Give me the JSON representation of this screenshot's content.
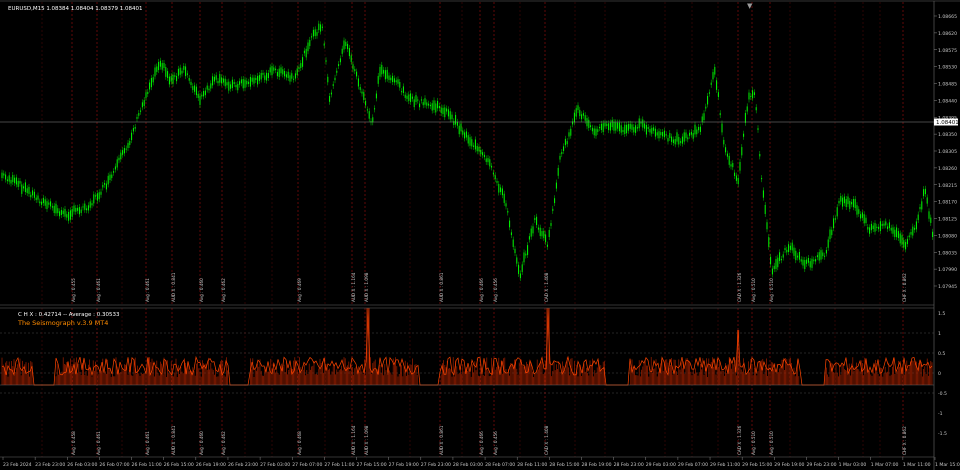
{
  "main": {
    "symbol_info": "EURUSD,M15  1.08384 1.08404 1.08379 1.08401",
    "current_price": "1.08401",
    "price_labels": [
      "1.08665",
      "1.08620",
      "1.08575",
      "1.08530",
      "1.08485",
      "1.08440",
      "1.08395",
      "1.08350",
      "1.08305",
      "1.08260",
      "1.08215",
      "1.08170",
      "1.08125",
      "1.08080",
      "1.08035",
      "1.07990",
      "1.07945"
    ]
  },
  "indicator": {
    "header": "C H X : 0.42714 -- Average : 0.30533",
    "title": "The Seismograph v.3.9 MT4",
    "levels": [
      "1.5",
      "1",
      "0.5",
      "0",
      "-0.5",
      "-1",
      "-1.5"
    ]
  },
  "time_axis": {
    "labels": [
      "23 Feb 2024",
      "23 Feb 23:00",
      "26 Feb 03:00",
      "26 Feb 07:00",
      "26 Feb 11:00",
      "26 Feb 15:00",
      "26 Feb 19:00",
      "26 Feb 23:00",
      "27 Feb 03:00",
      "27 Feb 07:00",
      "27 Feb 11:00",
      "27 Feb 15:00",
      "27 Feb 19:00",
      "27 Feb 23:00",
      "28 Feb 03:00",
      "28 Feb 07:00",
      "28 Feb 11:00",
      "28 Feb 15:00",
      "28 Feb 19:00",
      "28 Feb 23:00",
      "29 Feb 03:00",
      "29 Feb 07:00",
      "29 Feb 11:00",
      "29 Feb 15:00",
      "29 Feb 19:00",
      "29 Feb 23:00",
      "1 Mar 03:00",
      "1 Mar 07:00",
      "1 Mar 11:00",
      "1 Mar 15:00"
    ]
  },
  "events": [
    {
      "top": "Avg : 0.455",
      "bottom": "Avg : 0.458"
    },
    {
      "top": "Avg : 0.461",
      "bottom": "Avg : 0.461"
    },
    {
      "top": "Avg : 0.461",
      "bottom": "Avg : 0.461"
    },
    {
      "top": "AUD X : 0.841",
      "bottom": "AUD X : 0.841"
    },
    {
      "top": "Avg : 0.460",
      "bottom": "Avg : 0.460"
    },
    {
      "top": "Avg : 0.462",
      "bottom": "Avg : 0.462"
    },
    {
      "top": "Avg : 0.469",
      "bottom": "Avg : 0.468"
    },
    {
      "top": "AUD X : 1.164",
      "bottom": "AUD X : 1.164"
    },
    {
      "top": "AUD X : 1.098",
      "bottom": "AUD X : 1.098"
    },
    {
      "top": "AUD X : 0.861",
      "bottom": "AUD X : 0.861"
    },
    {
      "top": "Avg : 0.466",
      "bottom": "Avg : 0.466"
    },
    {
      "top": "Avg : 0.456",
      "bottom": "Avg : 0.456"
    },
    {
      "top": "CAD X : 1.408",
      "bottom": "CAD X : 1.408"
    },
    {
      "top": "CAD X : 1.326",
      "bottom": "CAD X : 1.326"
    },
    {
      "top": "Avg : 0.510",
      "bottom": "Avg : 0.510"
    },
    {
      "top": "Avg : 0.510",
      "bottom": "Avg : 0.510"
    },
    {
      "top": "CHF X : 0.862",
      "bottom": "CHF X : 0.862"
    }
  ],
  "colors": {
    "background": "#000000",
    "candles": "#00ff00",
    "grid": "#2a2a2a",
    "axis_text": "#c8c8c8",
    "event_line": "#a01010",
    "seismograph": "#ff4500",
    "indicator_title": "#ff8c00",
    "price_line": "#8c8c8c",
    "current_price_bg": "#ffffff"
  }
}
